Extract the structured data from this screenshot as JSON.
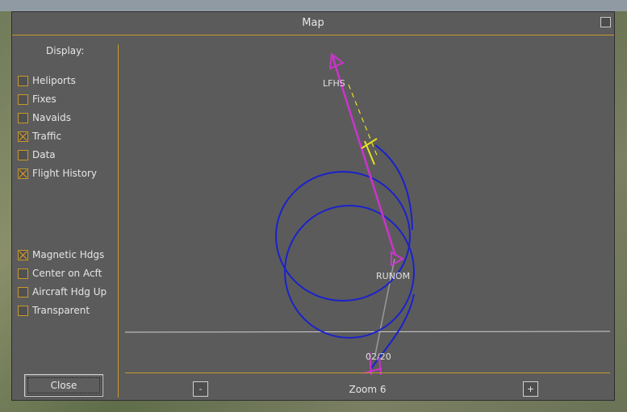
{
  "window": {
    "title": "Map"
  },
  "sidebar": {
    "display_label": "Display:",
    "options": [
      {
        "label": "Heliports",
        "checked": false
      },
      {
        "label": "Fixes",
        "checked": false
      },
      {
        "label": "Navaids",
        "checked": false
      },
      {
        "label": "Traffic",
        "checked": true
      },
      {
        "label": "Data",
        "checked": false
      },
      {
        "label": "Flight History",
        "checked": true
      },
      {
        "label": "Magnetic Hdgs",
        "checked": true
      },
      {
        "label": "Center on Acft",
        "checked": false
      },
      {
        "label": "Aircraft Hdg Up",
        "checked": false
      },
      {
        "label": "Transparent",
        "checked": false
      }
    ],
    "close_label": "Close"
  },
  "map": {
    "waypoints": [
      "LFHS",
      "RUNOM",
      "02/20"
    ],
    "colors": {
      "route": "#cc33cc",
      "history": "#1a22cc",
      "aircraft": "#e8e020",
      "accent": "#c89a2a"
    }
  },
  "zoom": {
    "minus_label": "-",
    "plus_label": "+",
    "level_label": "Zoom 6"
  }
}
